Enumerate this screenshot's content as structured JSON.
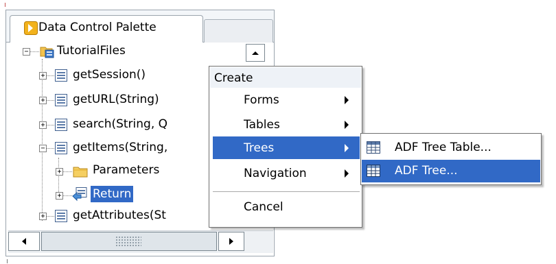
{
  "palette": {
    "tab_label": "Data Control Palette",
    "root": "TutorialFiles",
    "items": [
      "getSession()",
      "getURL(String)",
      "search(String, Q",
      "getItems(String,",
      "getAttributes(St"
    ],
    "children": [
      "Parameters",
      "Return"
    ]
  },
  "context_menu": {
    "header": "Create",
    "items": [
      "Forms",
      "Tables",
      "Trees",
      "Navigation"
    ],
    "cancel": "Cancel"
  },
  "submenu": {
    "items": [
      "ADF Tree Table...",
      "ADF Tree..."
    ]
  },
  "colors": {
    "selection": "#3169c6",
    "menu_header_bg": "#eef2f7"
  }
}
